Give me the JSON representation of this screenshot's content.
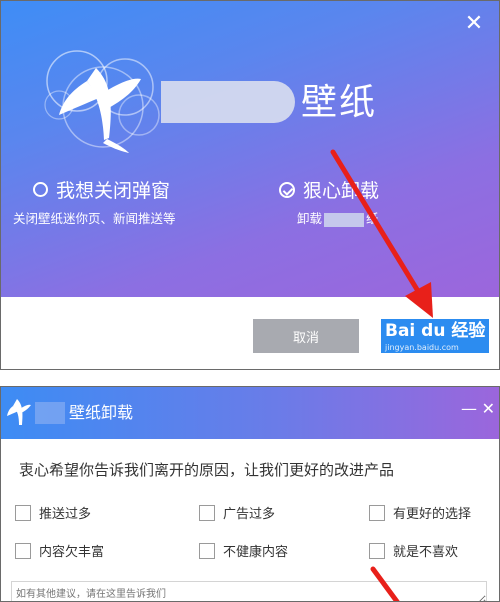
{
  "panel1": {
    "close_icon": "close-icon",
    "app_name_suffix": "壁纸",
    "option_keep": {
      "label": "我想关闭弹窗",
      "sub": "关闭壁纸迷你页、新闻推送等",
      "selected": false
    },
    "option_uninstall": {
      "label": "狠心卸载",
      "sub_prefix": "卸载",
      "sub_suffix": "纸",
      "selected": true
    },
    "cancel_label": "取消",
    "watermark": {
      "main": "Bai du 经验",
      "sub": "jingyan.baidu.com"
    }
  },
  "panel2": {
    "title": "壁纸卸载",
    "min_icon": "minimize-icon",
    "close_icon": "close-icon",
    "question": "衷心希望你告诉我们离开的原因，让我们更好的改进产品",
    "reasons": [
      {
        "label": "推送过多",
        "checked": false
      },
      {
        "label": "广告过多",
        "checked": false
      },
      {
        "label": "有更好的选择",
        "checked": false
      },
      {
        "label": "内容欠丰富",
        "checked": false
      },
      {
        "label": "不健康内容",
        "checked": false
      },
      {
        "label": "就是不喜欢",
        "checked": false
      }
    ],
    "feedback_placeholder": "如有其他建议，请在这里告诉我们"
  },
  "colors": {
    "accent_blue": "#2c8cf0",
    "arrow_red": "#e8201a",
    "gradient_start": "#3e8df6",
    "gradient_end": "#9c66dc"
  }
}
